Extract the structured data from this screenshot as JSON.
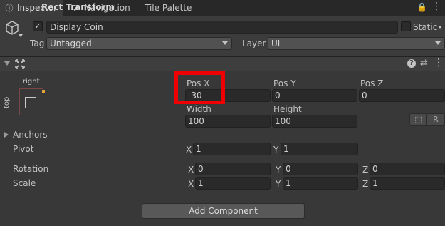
{
  "tabs": [
    {
      "label": "Inspector",
      "icon": "info-icon",
      "active": true
    },
    {
      "label": "Navigation",
      "icon": "navigation-icon",
      "active": false
    },
    {
      "label": "Tile Palette",
      "icon": "",
      "active": false
    }
  ],
  "gameobject": {
    "name": "Display Coin",
    "active": true,
    "static_label": "Static",
    "tag_label": "Tag",
    "tag_value": "Untagged",
    "layer_label": "Layer",
    "layer_value": "UI"
  },
  "component": {
    "title": "Rect Transform",
    "anchor_preset_h": "right",
    "anchor_preset_v": "top",
    "pos_x_label": "Pos X",
    "pos_y_label": "Pos Y",
    "pos_z_label": "Pos Z",
    "pos_x": "-30",
    "pos_y": "0",
    "pos_z": "0",
    "width_label": "Width",
    "height_label": "Height",
    "width": "100",
    "height": "100",
    "raw_edit_label": "R",
    "anchors_label": "Anchors",
    "pivot_label": "Pivot",
    "pivot": {
      "x": "1",
      "y": "1"
    },
    "rotation_label": "Rotation",
    "rotation": {
      "x": "0",
      "y": "0",
      "z": "0"
    },
    "scale_label": "Scale",
    "scale": {
      "x": "1",
      "y": "1",
      "z": "1"
    },
    "axis_x": "X",
    "axis_y": "Y",
    "axis_z": "Z"
  },
  "add_component_label": "Add Component",
  "colors": {
    "highlight": "#ee0000",
    "anchor_dot": "#e2a43a",
    "background": "#383838"
  }
}
